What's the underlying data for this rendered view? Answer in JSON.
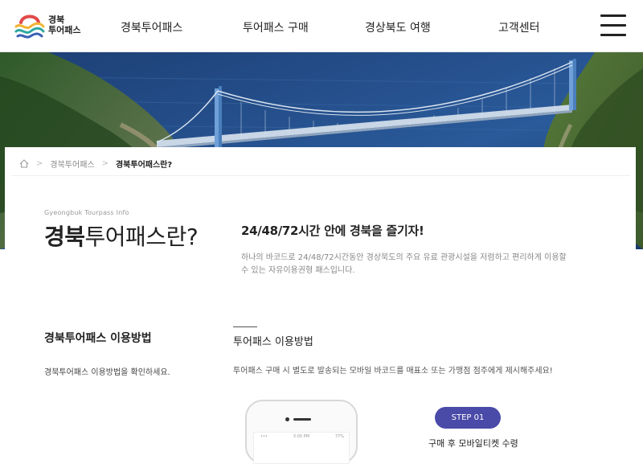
{
  "header": {
    "logo_line1": "경북",
    "logo_line2": "투어패스",
    "nav": [
      "경북투어패스",
      "투어패스 구매",
      "경상북도 여행",
      "고객센터"
    ],
    "menu_icon": "hamburger-icon"
  },
  "breadcrumb": {
    "home_icon": "home-icon",
    "items": [
      "경북투어패스",
      "경북투어패스란?"
    ]
  },
  "intro": {
    "subtitle_en": "Gyeongbuk Tourpass Info",
    "title_bold": "경북",
    "title_rest": "투어패스란?",
    "tagline": "24/48/72시간 안에 경북을 즐기자!",
    "description": "하나의 바코드로 24/48/72시간동안 경상북도의 주요 유료 관광시설을 저렴하고 편리하게 이용할 수 있는 자유이용권형 패스입니다."
  },
  "how_to": {
    "left_title": "경북투어패스 이용방법",
    "left_desc": "경북투어패스 이용방법을 확인하세요.",
    "right_title": "투어패스 이용방법",
    "right_desc": "투어패스 구매 시 별도로 발송되는 모바일 바코드를 매표소 또는 가맹점 점주에게 제시해주세요!",
    "phone_status_time": "3:00 PM",
    "phone_status_battery": "77%",
    "step_label": "STEP 01",
    "step_desc": "구매 후 모바일티켓 수령"
  },
  "colors": {
    "step_badge": "#4a4aa8",
    "sea": "#1f4e8c",
    "bridge": "#6fa0d8"
  }
}
